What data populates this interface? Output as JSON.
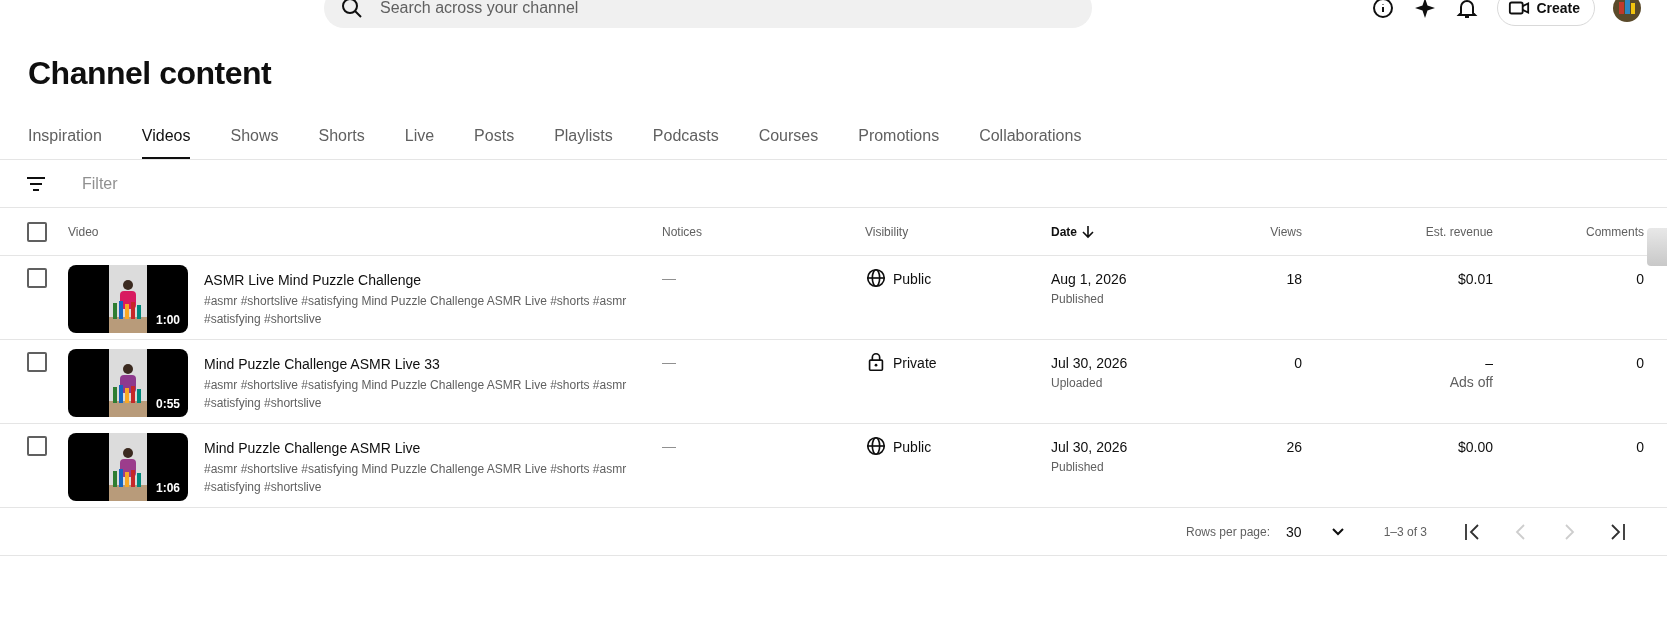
{
  "topbar": {
    "search": {
      "placeholder": "Search across your channel"
    },
    "create_label": "Create"
  },
  "page_title": "Channel content",
  "tabs": [
    {
      "label": "Inspiration",
      "selected": false
    },
    {
      "label": "Videos",
      "selected": true
    },
    {
      "label": "Shows",
      "selected": false
    },
    {
      "label": "Shorts",
      "selected": false
    },
    {
      "label": "Live",
      "selected": false
    },
    {
      "label": "Posts",
      "selected": false
    },
    {
      "label": "Playlists",
      "selected": false
    },
    {
      "label": "Podcasts",
      "selected": false
    },
    {
      "label": "Courses",
      "selected": false
    },
    {
      "label": "Promotions",
      "selected": false
    },
    {
      "label": "Collaborations",
      "selected": false
    }
  ],
  "filter": {
    "placeholder": "Filter"
  },
  "table": {
    "select_all_checked": false,
    "columns": [
      {
        "label": "Video",
        "sorted": false
      },
      {
        "label": "Notices",
        "sorted": false
      },
      {
        "label": "Visibility",
        "sorted": false
      },
      {
        "label": "Date",
        "sorted": true
      },
      {
        "label": "Views",
        "sorted": false
      },
      {
        "label": "Est. revenue",
        "sorted": false
      },
      {
        "label": "Comments",
        "sorted": false
      }
    ],
    "rows": [
      {
        "checked": false,
        "duration": "1:00",
        "title": "ASMR Live Mind Puzzle Challenge",
        "description": "#asmr #shortslive #satisfying Mind Puzzle Challenge ASMR Live #shorts #asmr #satisfying #shortslive",
        "notices": "—",
        "visibility": {
          "kind": "public",
          "label": "Public"
        },
        "date": "Aug 1, 2026",
        "date_status": "Published",
        "views": "18",
        "revenue": "$0.01",
        "comments": "0"
      },
      {
        "checked": false,
        "duration": "0:55",
        "title": "Mind Puzzle Challenge ASMR Live 33",
        "description": "#asmr #shortslive #satisfying Mind Puzzle Challenge ASMR Live #shorts #asmr #satisfying #shortslive",
        "notices": "—",
        "visibility": {
          "kind": "private",
          "label": "Private"
        },
        "date": "Jul 30, 2026",
        "date_status": "Uploaded",
        "views": "0",
        "revenue": "–",
        "revenue_note": "Ads off",
        "comments": "0"
      },
      {
        "checked": false,
        "duration": "1:06",
        "title": "Mind Puzzle Challenge ASMR Live",
        "description": "#asmr #shortslive #satisfying Mind Puzzle Challenge ASMR Live #shorts #asmr #satisfying #shortslive",
        "notices": "—",
        "visibility": {
          "kind": "public",
          "label": "Public"
        },
        "date": "Jul 30, 2026",
        "date_status": "Published",
        "views": "26",
        "revenue": "$0.00",
        "comments": "0"
      }
    ]
  },
  "pagination": {
    "rows_per_page_label": "Rows per page:",
    "rows_per_page": "30",
    "range": "1–3 of 3",
    "buttons": [
      {
        "kind": "first",
        "disabled": false
      },
      {
        "kind": "previous",
        "disabled": true
      },
      {
        "kind": "next",
        "disabled": true
      },
      {
        "kind": "last",
        "disabled": false
      }
    ]
  }
}
